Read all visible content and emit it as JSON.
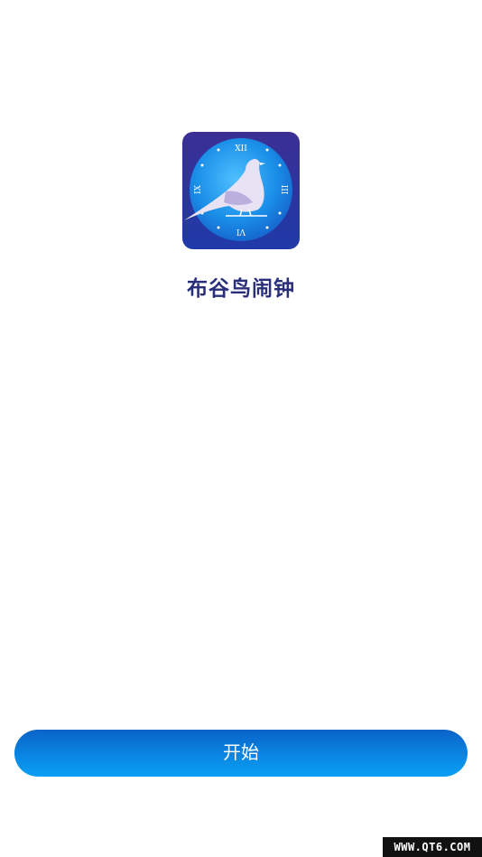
{
  "app": {
    "name": "布谷鸟闹钟",
    "icon": "cuckoo-clock-logo",
    "icon_numerals": {
      "top": "XII",
      "left": "IX",
      "right": "III",
      "bottom": "VI"
    }
  },
  "start_button": {
    "label": "开始"
  },
  "watermark": {
    "text": "WWW.QT6.COM"
  },
  "colors": {
    "title": "#2a2f7c",
    "button_top": "#0a63c8",
    "button_bottom": "#0aa0f4",
    "icon_bg": "#2b2f8f",
    "clock_face": "#1a8fe8"
  }
}
